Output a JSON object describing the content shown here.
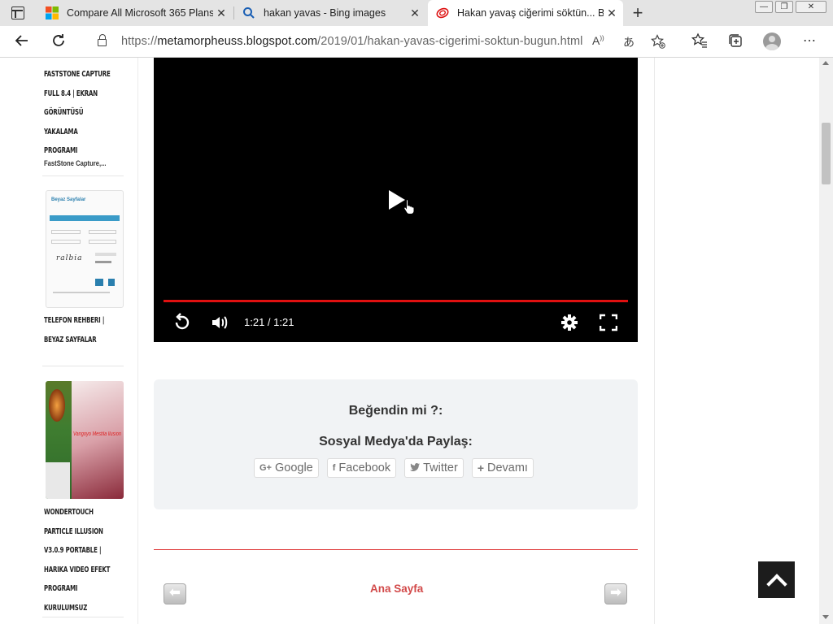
{
  "browser": {
    "tabs": [
      {
        "title": "Compare All Microsoft 365 Plans",
        "icon": "microsoft-logo-icon"
      },
      {
        "title": "hakan yavas - Bing images",
        "icon": "search-icon"
      },
      {
        "title": "Hakan yavaş ciğerimi söktün... Bu",
        "icon": "blogspot-icon",
        "active": true
      }
    ],
    "url_prefix": "https://",
    "url_host": "metamorpheuss.blogspot.com",
    "url_path": "/2019/01/hakan-yavas-cigerimi-soktun-bugun.html",
    "new_tab_symbol": "+"
  },
  "sidebar": {
    "post1_title_lines": [
      "FASTSTONE CAPTURE",
      "FULL 8.4 | EKRAN",
      "GÖRÜNTÜSÜ YAKALAMA",
      "PROGRAMI"
    ],
    "post1_snippet": "FastStone Capture,...",
    "thumb1_header": "Beyaz Sayfalar",
    "thumb1_captcha": "ralbia",
    "post2_title_lines": [
      "TELEFON REHBERİ |",
      "BEYAZ SAYFALAR"
    ],
    "thumb2_text": "Vangoyo Mestila Ilusion",
    "post3_title_lines": [
      "WONDERTOUCH",
      "PARTICLE ILLUSION",
      "V3.0.9 PORTABLE |",
      "HARIKA VIDEO EFEKT",
      "PROGRAMI KURULUMSUZ"
    ]
  },
  "video": {
    "time": "1:21 / 1:21",
    "progress": 1.0
  },
  "share": {
    "question": "Beğendin mi ?:",
    "title": "Sosyal Medya'da Paylaş:",
    "buttons": [
      {
        "label": "Google",
        "icon": "G+"
      },
      {
        "label": "Facebook",
        "icon": "f"
      },
      {
        "label": "Twitter",
        "icon": "twitter-bird"
      },
      {
        "label": "Devamı",
        "icon": "+"
      }
    ]
  },
  "pager": {
    "home_label": "Ana Sayfa"
  },
  "colors": {
    "accent": "#d24a4a",
    "progress": "#e01010",
    "share_bg": "#f1f3f5"
  }
}
